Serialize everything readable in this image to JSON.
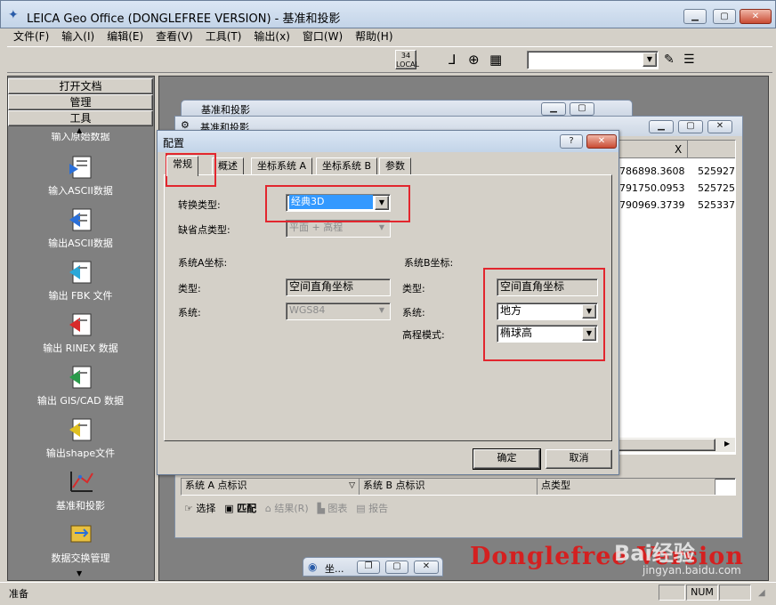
{
  "app": {
    "title": "LEICA Geo Office (DONGLEFREE VERSION) - 基准和投影",
    "status_left": "准备",
    "status_num": "NUM",
    "watermark": "Donglefree Version",
    "baidu": "Bai经验",
    "baidu_url": "jingyan.baidu.com"
  },
  "menu": [
    "文件(F)",
    "输入(I)",
    "编辑(E)",
    "查看(V)",
    "工具(T)",
    "输出(x)",
    "窗口(W)",
    "帮助(H)"
  ],
  "toolbar": {
    "local_badge": "34 LOCAL"
  },
  "sidebar": {
    "buttons": [
      "打开文档",
      "管理",
      "工具"
    ],
    "items": [
      {
        "label": "输入原始数据"
      },
      {
        "label": "输入ASCII数据"
      },
      {
        "label": "输出ASCII数据"
      },
      {
        "label": "输出 FBK 文件"
      },
      {
        "label": "输出 RINEX 数据"
      },
      {
        "label": "输出 GIS/CAD 数据"
      },
      {
        "label": "输出shape文件"
      },
      {
        "label": "基准和投影"
      },
      {
        "label": "数据交换管理"
      }
    ]
  },
  "inner": {
    "back_title": "基准和投影",
    "win_title": "基准和投影",
    "col_x": "X",
    "rows": [
      [
        "786898.3608",
        "525927"
      ],
      [
        "791750.0953",
        "525725"
      ],
      [
        "790969.3739",
        "525337"
      ]
    ],
    "bottom_cols": [
      "系统 A 点标识",
      "系统 B 点标识",
      "点类型"
    ],
    "bottom_tabs": [
      "选择",
      "匹配",
      "结果(R)",
      "图表",
      "报告"
    ],
    "mini_title": "坐..."
  },
  "dialog": {
    "title": "配置",
    "tabs": [
      "常规",
      "概述",
      "坐标系统 A",
      "坐标系统 B",
      "参数"
    ],
    "transform_label": "转换类型:",
    "transform_value": "经典3D",
    "missing_label": "缺省点类型:",
    "missing_value": "平面 + 高程",
    "sysA_header": "系统A坐标:",
    "sysA_type_label": "类型:",
    "sysA_type_value": "空间直角坐标",
    "sysA_sys_label": "系统:",
    "sysA_sys_value": "WGS84",
    "sysB_header": "系统B坐标:",
    "sysB_type_label": "类型:",
    "sysB_type_value": "空间直角坐标",
    "sysB_sys_label": "系统:",
    "sysB_sys_value": "地方",
    "height_label": "高程模式:",
    "height_value": "椭球高",
    "ok": "确定",
    "cancel": "取消"
  },
  "colors": {
    "highlight": "#3399ff",
    "red_annotation": "#e2262e",
    "watermark": "#d42020"
  }
}
